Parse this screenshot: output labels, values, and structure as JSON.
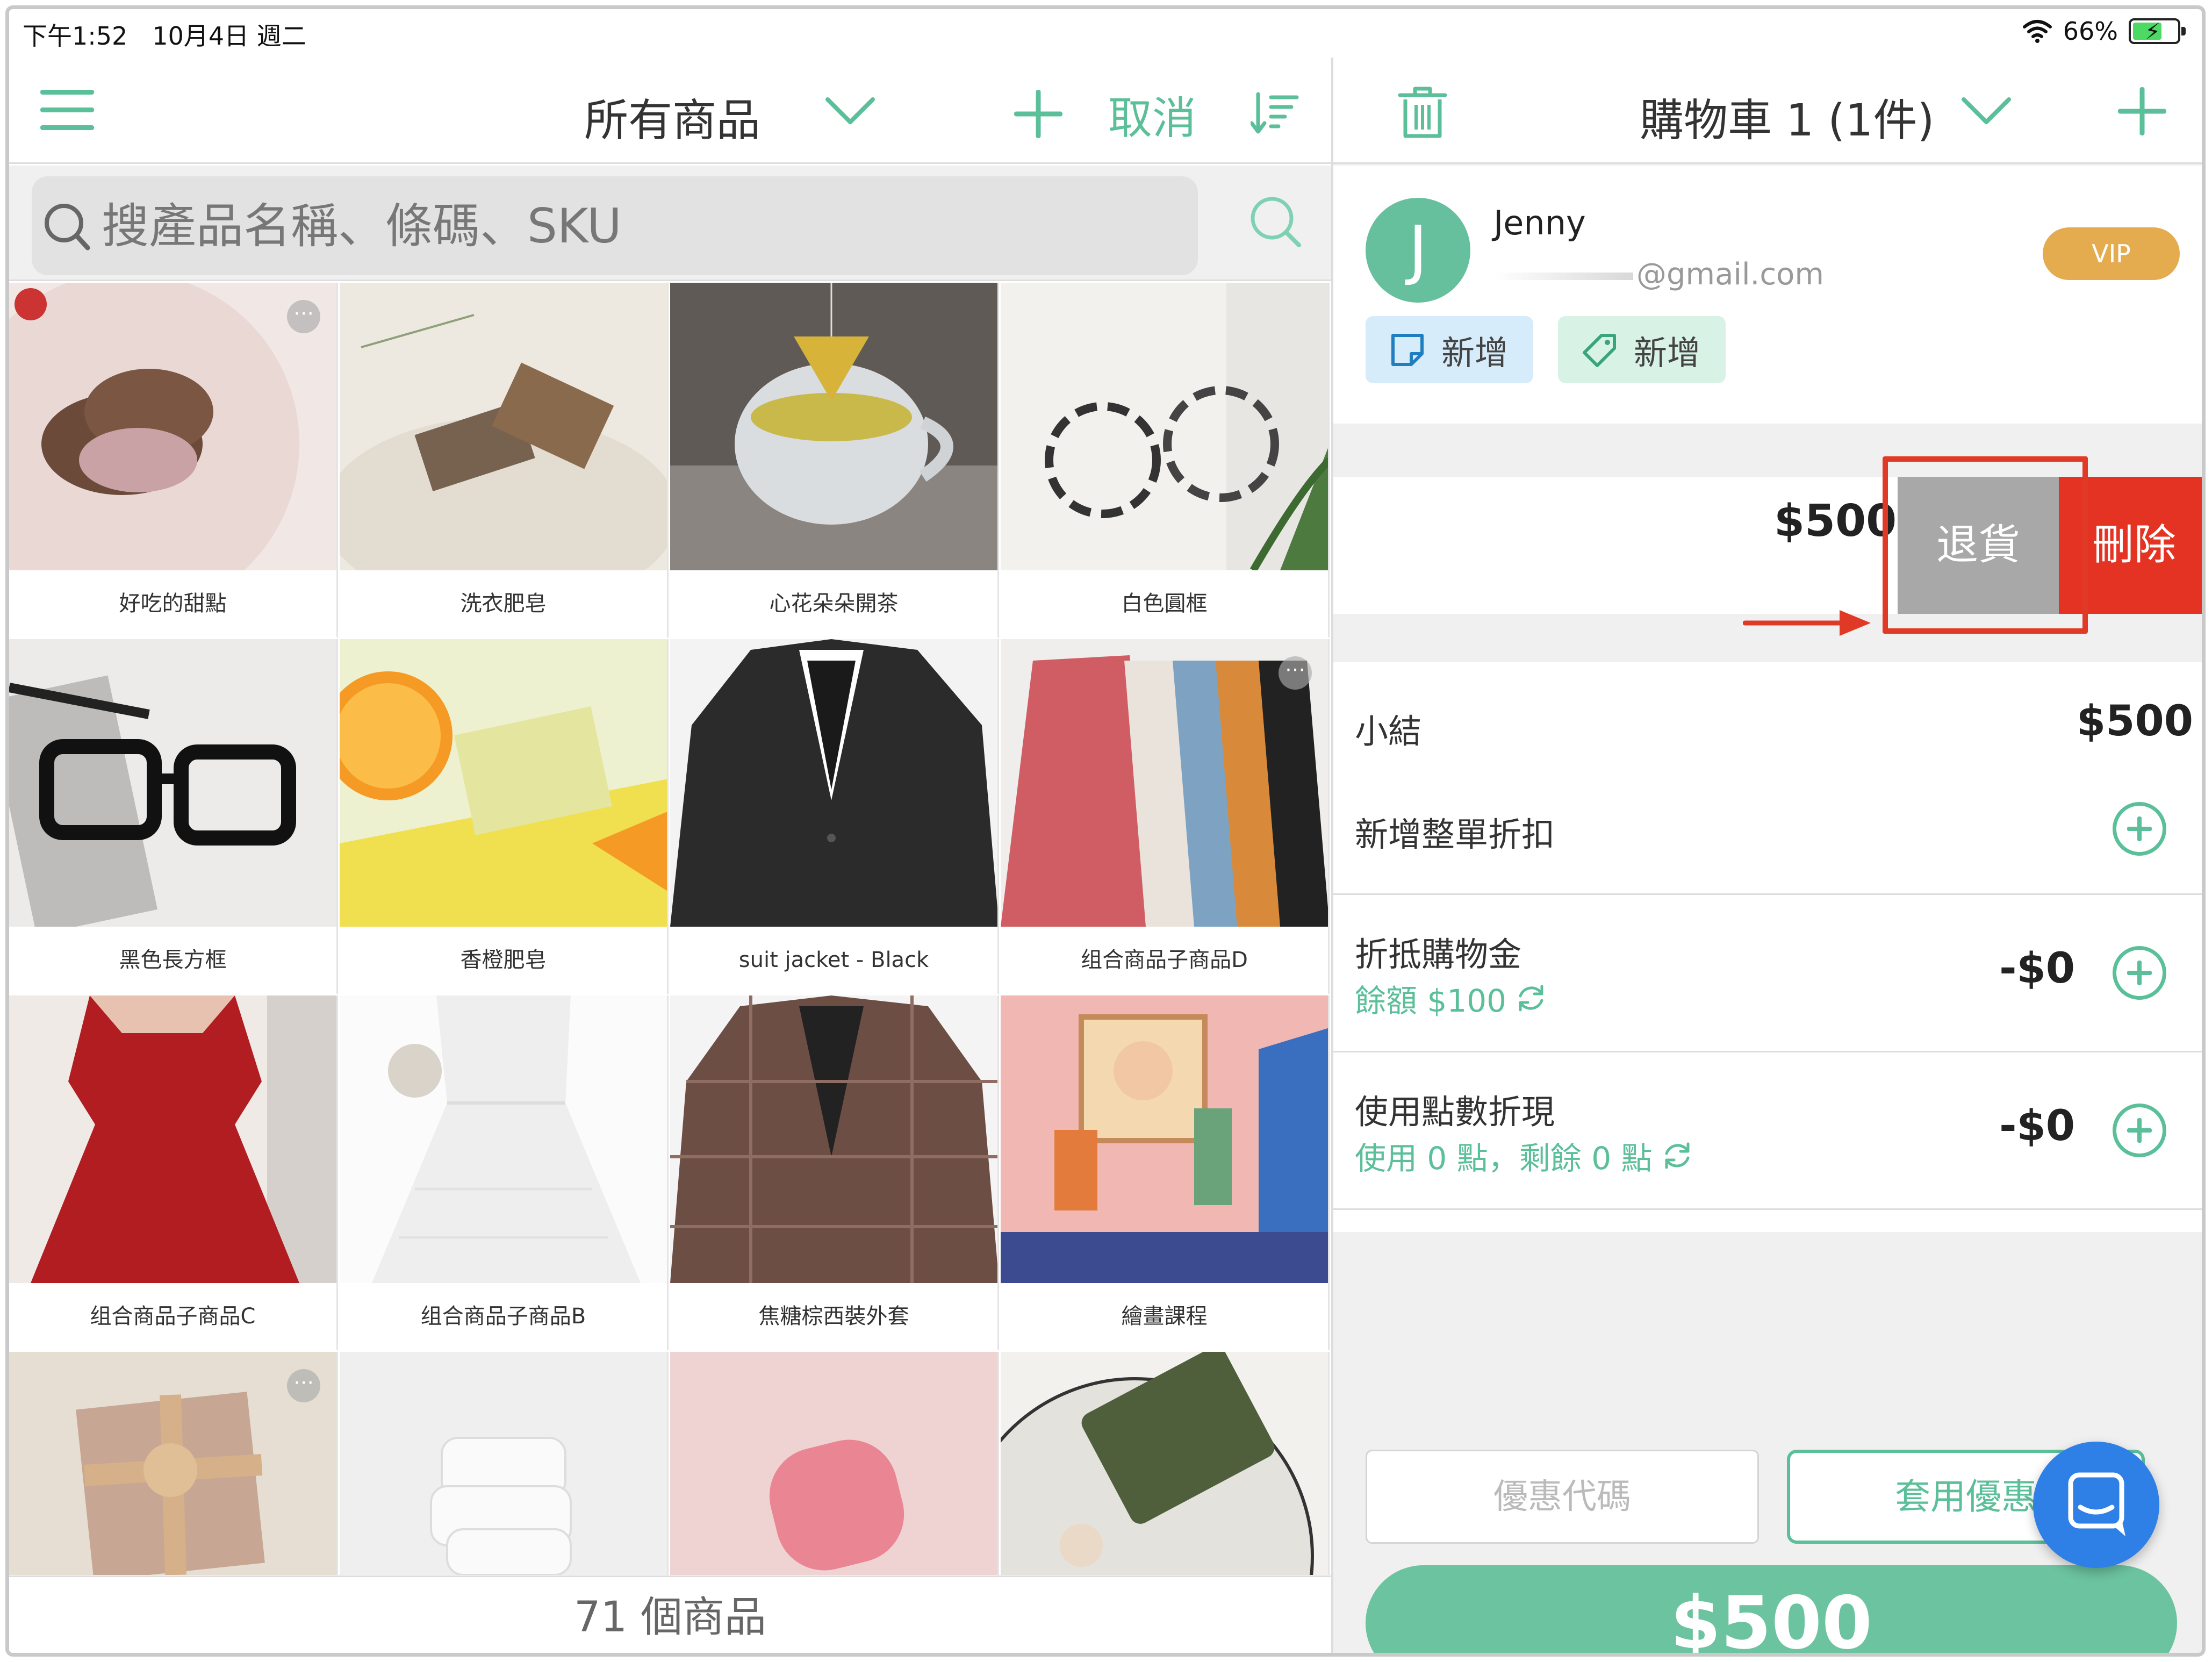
{
  "status_bar": {
    "time": "下午1:52　10月4日 週二",
    "battery": "66%",
    "battery_level": 0.66
  },
  "catalog": {
    "title": "所有商品",
    "cancel_label": "取消",
    "search": {
      "placeholder": "搜產品名稱、條碼、SKU"
    },
    "footer_count": "71 個商品",
    "products": [
      {
        "name": "好吃的甜點",
        "image": "dessert-photo",
        "more": true
      },
      {
        "name": "洗衣肥皂",
        "image": "soap-photo"
      },
      {
        "name": "心花朵朵開茶",
        "image": "tea-photo"
      },
      {
        "name": "白色圓框",
        "image": "glasses-photo"
      },
      {
        "name": "黑色長方框",
        "image": "black-glasses-photo"
      },
      {
        "name": "香橙肥皂",
        "image": "orange-soap-photo"
      },
      {
        "name": "suit jacket - Black",
        "image": "suit-photo"
      },
      {
        "name": "组合商品子商品D",
        "image": "dresses-photo",
        "more": true
      },
      {
        "name": "组合商品子商品C",
        "image": "red-dress-photo"
      },
      {
        "name": "组合商品子商品B",
        "image": "white-dress-photo"
      },
      {
        "name": "焦糖棕西裝外套",
        "image": "brown-blazer-photo"
      },
      {
        "name": "繪畫課程",
        "image": "painting-photo"
      },
      {
        "name": "",
        "image": "gift-photo",
        "more": true
      },
      {
        "name": "",
        "image": "white-soap-photo"
      },
      {
        "name": "",
        "image": "pink-soap-photo"
      },
      {
        "name": "",
        "image": "green-soap-photo"
      }
    ]
  },
  "cart": {
    "title": "購物車 1 (1件)",
    "customer": {
      "initial": "J",
      "name": "Jenny",
      "email": "@gmail.com",
      "badge": "VIP",
      "note_add": "新增",
      "tag_add": "新增"
    },
    "item": {
      "price": "$500",
      "return_label": "退貨",
      "delete_label": "刪除"
    },
    "summary": {
      "subtotal_label": "小結",
      "subtotal_value": "$500",
      "order_discount_label": "新增整單折扣",
      "credit_label": "折抵購物金",
      "credit_sub": "餘額 $100",
      "credit_value": "-$0",
      "points_label": "使用點數折現",
      "points_sub": "使用 0 點，剩餘 0 點",
      "points_value": "-$0"
    },
    "coupon": {
      "placeholder": "優惠代碼",
      "apply_label": "套用優惠"
    },
    "checkout_total": "$500"
  },
  "colors": {
    "accent": "#5bbf9a",
    "delete": "#e43322",
    "return": "#a8a8a8",
    "vip": "#e5ab4f",
    "checkout": "#6cc3a0",
    "annotation": "#e03a26",
    "chat": "#2e7fe6"
  }
}
